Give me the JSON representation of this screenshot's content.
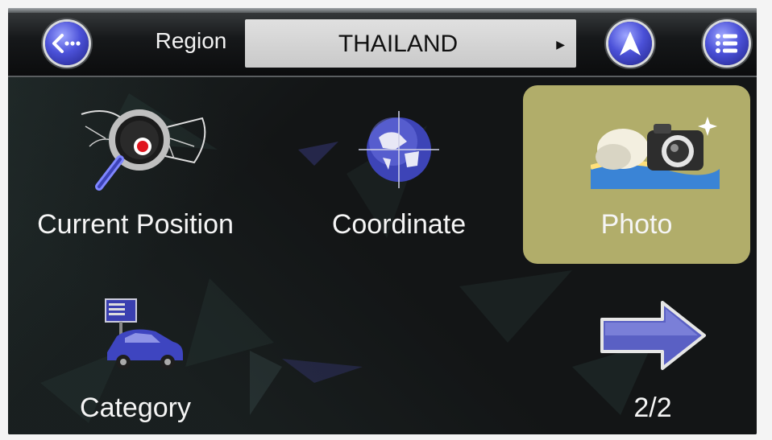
{
  "header": {
    "back_icon": "back-ellipsis-icon",
    "region_label": "Region",
    "region_value": "THAILAND",
    "region_arrow": "▶",
    "navigate_icon": "navigation-arrow-icon",
    "menu_icon": "list-menu-icon"
  },
  "tiles": [
    {
      "label": "Current Position",
      "icon": "map-magnifier-icon",
      "selected": false
    },
    {
      "label": "Coordinate",
      "icon": "globe-icon",
      "selected": false
    },
    {
      "label": "Photo",
      "icon": "camera-icon",
      "selected": true
    },
    {
      "label": "Category",
      "icon": "car-sign-icon",
      "selected": false
    }
  ],
  "pager": {
    "label": "2/2",
    "icon": "next-page-arrow-icon"
  },
  "colors": {
    "accent": "#4b51d8",
    "highlight": "#b1ad6a",
    "background": "#131516"
  }
}
